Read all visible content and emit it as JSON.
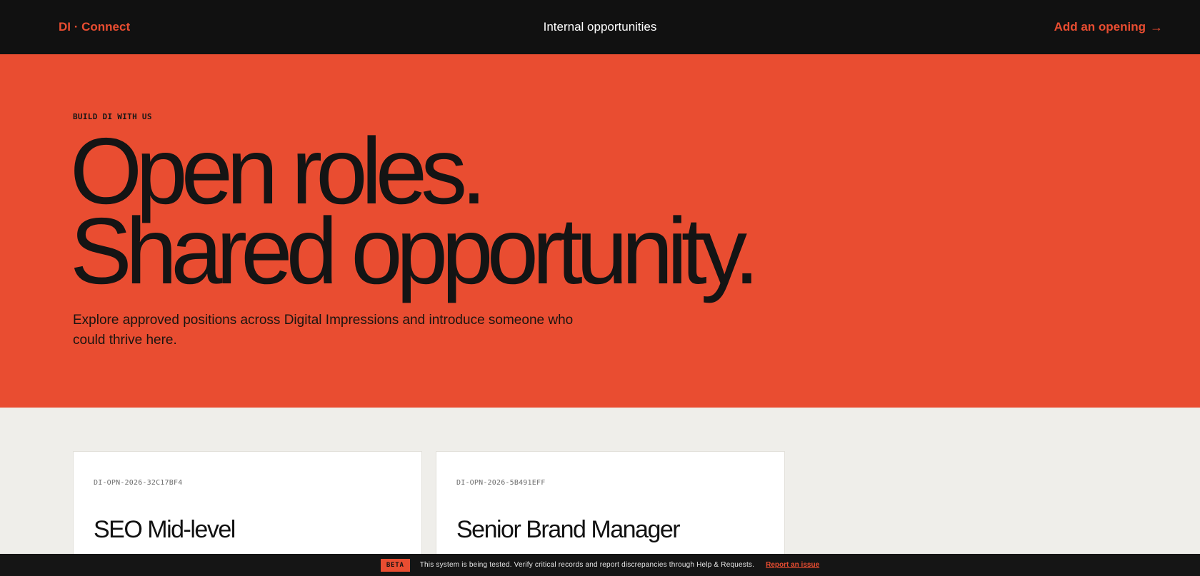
{
  "nav": {
    "brand": "DI · Connect",
    "title": "Internal opportunities",
    "add_opening_label": "Add an opening",
    "add_opening_icon": "arrow-right-icon",
    "arrow_glyph": "→"
  },
  "hero": {
    "eyebrow": "BUILD DI WITH US",
    "headline_line1": "Open roles.",
    "headline_line2": "Shared opportunity.",
    "subtitle": "Explore approved positions across Digital Impressions and introduce someone who could thrive here."
  },
  "cards": [
    {
      "code": "DI-OPN-2026-32C17BF4",
      "title": "SEO Mid-level"
    },
    {
      "code": "DI-OPN-2026-5B491EFF",
      "title": "Senior Brand Manager"
    }
  ],
  "banner": {
    "badge": "BETA",
    "message": "This system is being tested. Verify critical records and report discrepancies through Help & Requests.",
    "link_label": "Report an issue"
  },
  "colors": {
    "accent": "#e94d31",
    "dark": "#111111",
    "background": "#efeeea"
  }
}
